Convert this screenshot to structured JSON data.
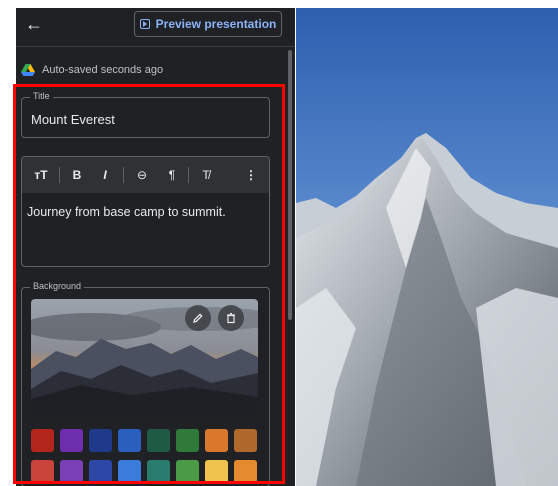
{
  "header": {
    "back_label": "←",
    "preview_button": "Preview presentation"
  },
  "status": {
    "autosave": "Auto-saved seconds ago"
  },
  "title_field": {
    "label": "Title",
    "value": "Mount Everest"
  },
  "editor": {
    "toolbar": {
      "text_size": "тT",
      "bold": "B",
      "italic": "I",
      "link": "⊖",
      "paragraph": "¶",
      "clear": "T̸",
      "more": "⋮"
    },
    "body_text": "Journey from base camp to summit."
  },
  "background": {
    "label": "Background",
    "edit_icon": "pencil-icon",
    "delete_icon": "trash-icon",
    "swatches_row1": [
      "#b3261e",
      "#6d2fae",
      "#1f3a8a",
      "#2b5fbd",
      "#1f5a45",
      "#2f7a3a",
      "#d9782d",
      "#b0692c"
    ],
    "swatches_row2": [
      "#c9443a",
      "#7b3fb8",
      "#2c47a6",
      "#3b7bd9",
      "#2a7d6e",
      "#4a9a46",
      "#efc34e",
      "#e58a2f"
    ]
  },
  "colors": {
    "accent": "#8ab4f8",
    "panel": "#202124",
    "highlight": "#ff0000"
  }
}
